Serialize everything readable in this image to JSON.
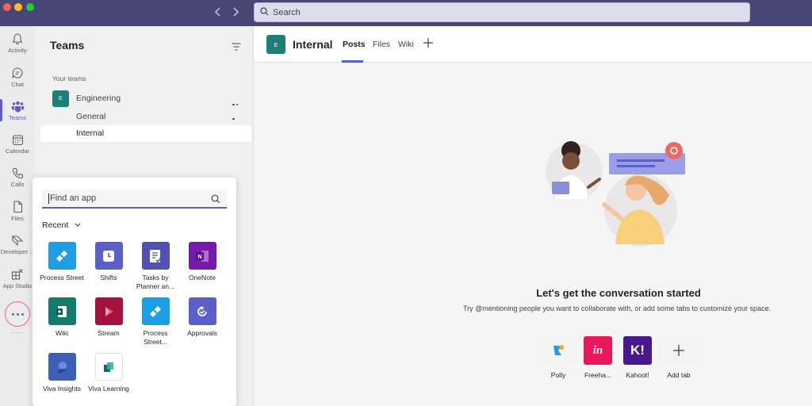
{
  "window": {
    "search_placeholder": "Search"
  },
  "rail": {
    "items": [
      {
        "label": "Activity",
        "icon": "bell-icon"
      },
      {
        "label": "Chat",
        "icon": "chat-icon"
      },
      {
        "label": "Teams",
        "icon": "teams-icon",
        "active": true
      },
      {
        "label": "Calendar",
        "icon": "calendar-icon"
      },
      {
        "label": "Calls",
        "icon": "phone-icon"
      },
      {
        "label": "Files",
        "icon": "file-icon"
      },
      {
        "label": "Developer ...",
        "icon": "developer-icon"
      },
      {
        "label": "App Studio",
        "icon": "app-studio-icon"
      }
    ]
  },
  "teams_panel": {
    "title": "Teams",
    "section_label": "Your teams",
    "team": {
      "avatar": "E",
      "name": "Engineering"
    },
    "channels": [
      "General",
      "Internal"
    ]
  },
  "flyout": {
    "search_placeholder": "Find an app",
    "recent_label": "Recent",
    "apps": [
      {
        "name": "Process Street",
        "color": "#1f9ee8"
      },
      {
        "name": "Shifts",
        "color": "#5b5fc7"
      },
      {
        "name": "Tasks by Planner an...",
        "color": "#4f52b2"
      },
      {
        "name": "OneNote",
        "color": "#7719aa"
      },
      {
        "name": "Wiki",
        "color": "#137a6e"
      },
      {
        "name": "Stream",
        "color": "#a4133c"
      },
      {
        "name": "Process Street...",
        "color": "#1f9ee8"
      },
      {
        "name": "Approvals",
        "color": "#5b5fc7"
      },
      {
        "name": "Viva Insights",
        "color": "#3c5fb8"
      },
      {
        "name": "Viva Learning",
        "color": "#ffffff"
      }
    ]
  },
  "channel_header": {
    "avatar": "E",
    "title": "Internal",
    "tabs": [
      "Posts",
      "Files",
      "Wiki"
    ]
  },
  "empty_state": {
    "title": "Let's get the conversation started",
    "subtitle": "Try @mentioning people you want to collaborate with, or add some tabs to customize your space.",
    "suggestions": [
      {
        "name": "Polly",
        "color": "#f3f3f3"
      },
      {
        "name": "Freeha...",
        "color": "#e9175b"
      },
      {
        "name": "Kahoot!",
        "color": "#46178f"
      },
      {
        "name": "Add tab",
        "color": "#f3f3f3"
      }
    ]
  },
  "colors": {
    "accent": "#5b5fc7",
    "titlebar": "#464775",
    "team_avatar": "#1e7f78"
  }
}
